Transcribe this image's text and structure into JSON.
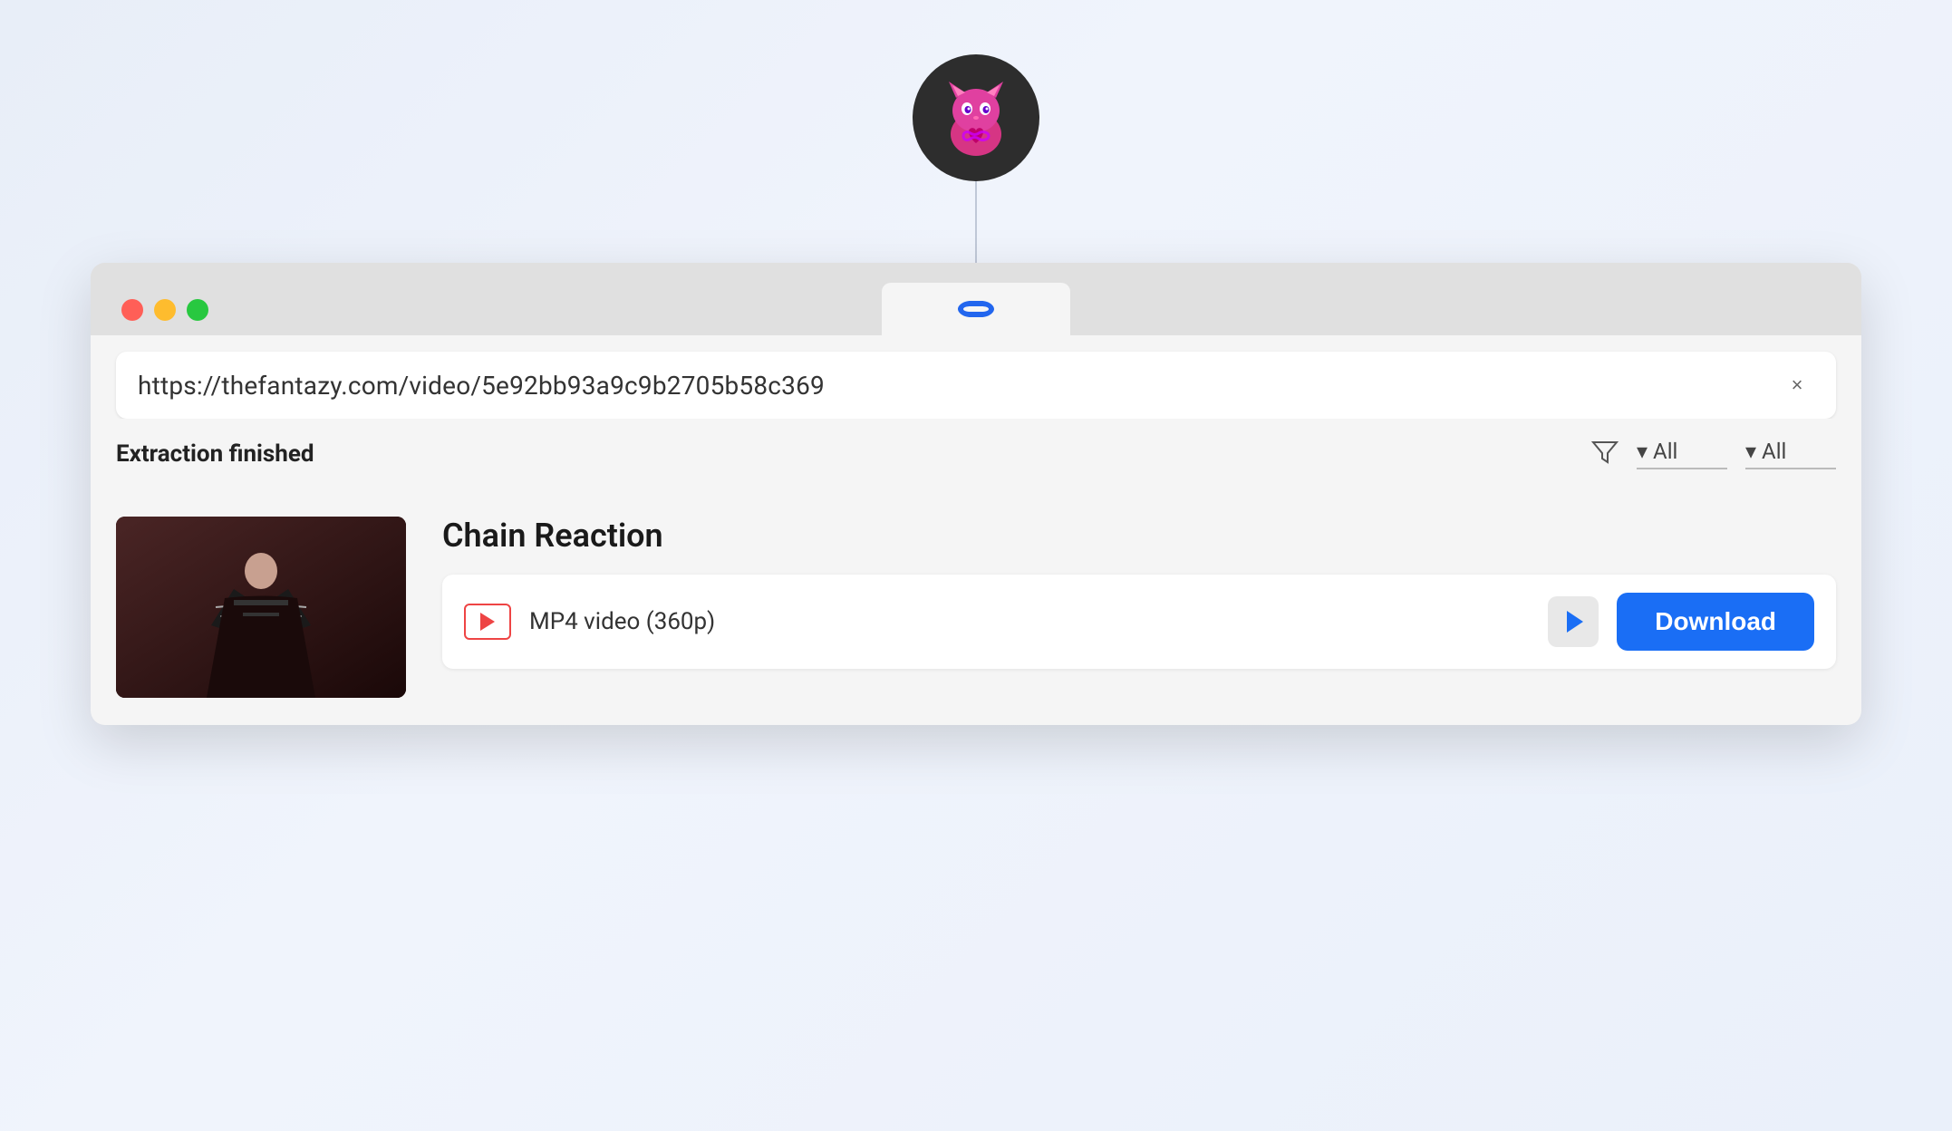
{
  "app": {
    "icon_label": "Fantazy Downloader App Icon"
  },
  "window": {
    "controls": {
      "close_label": "Close",
      "minimize_label": "Minimize",
      "maximize_label": "Maximize"
    },
    "tab_icon": "chain-link-icon"
  },
  "url_bar": {
    "url": "https://thefantazy.com/video/5e92bb93a9c9b2705b58c369",
    "clear_label": "×"
  },
  "filter_bar": {
    "status_label": "Extraction finished",
    "filter_icon": "filter-icon",
    "dropdown1": {
      "value": "All",
      "arrow": "▾"
    },
    "dropdown2": {
      "value": "All",
      "arrow": "▾"
    }
  },
  "video": {
    "title": "Chain Reaction",
    "format": {
      "icon_label": "mp4-video-icon",
      "label": "MP4 video (360p)",
      "preview_label": "Preview",
      "download_label": "Download"
    }
  }
}
